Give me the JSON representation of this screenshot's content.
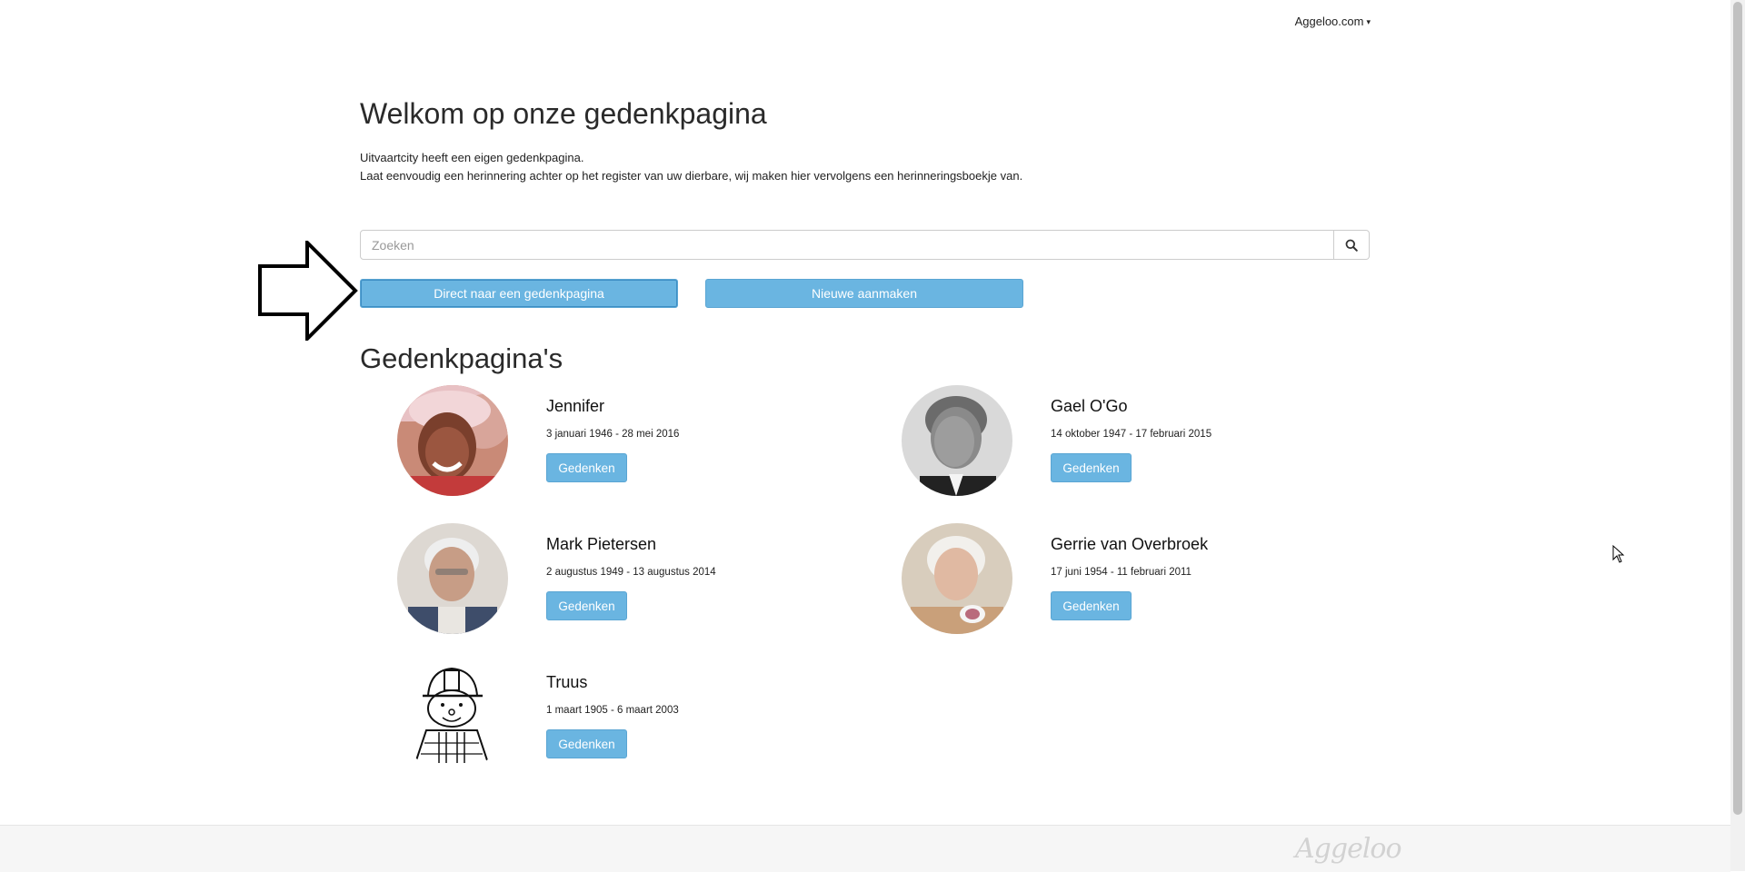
{
  "topbar": {
    "site_menu_label": "Aggeloo.com",
    "caret": "▾"
  },
  "header": {
    "title": "Welkom op onze gedenkpagina",
    "intro_line1": "Uitvaartcity heeft een eigen gedenkpagina.",
    "intro_line2": "Laat eenvoudig een herinnering achter op het register van uw dierbare, wij maken hier vervolgens een herinneringsboekje van."
  },
  "search": {
    "placeholder": "Zoeken",
    "value": "",
    "icon": "search-icon"
  },
  "buttons": {
    "direct_label": "Direct naar een gedenkpagina",
    "new_label": "Nieuwe aanmaken"
  },
  "section": {
    "title": "Gedenkpagina's"
  },
  "memorials": [
    {
      "name": "Jennifer",
      "dates": "3 januari 1946 - 28 mei 2016",
      "button": "Gedenken",
      "photo": "woman-smiling-photo"
    },
    {
      "name": "Gael O'Go",
      "dates": "14 oktober 1947 - 17 februari 2015",
      "button": "Gedenken",
      "photo": "man-portrait-photo"
    },
    {
      "name": "Mark Pietersen",
      "dates": "2 augustus 1949 - 13 augustus 2014",
      "button": "Gedenken",
      "photo": "elderly-man-photo"
    },
    {
      "name": "Gerrie van Overbroek",
      "dates": "17 juni 1954 - 11 februari 2011",
      "button": "Gedenken",
      "photo": "elderly-woman-photo"
    },
    {
      "name": "Truus",
      "dates": "1 maart 1905 - 6 maart 2003",
      "button": "Gedenken",
      "photo": "cartoon-builder-drawing"
    }
  ],
  "footer": {
    "logo_text": "Aggeloo"
  }
}
